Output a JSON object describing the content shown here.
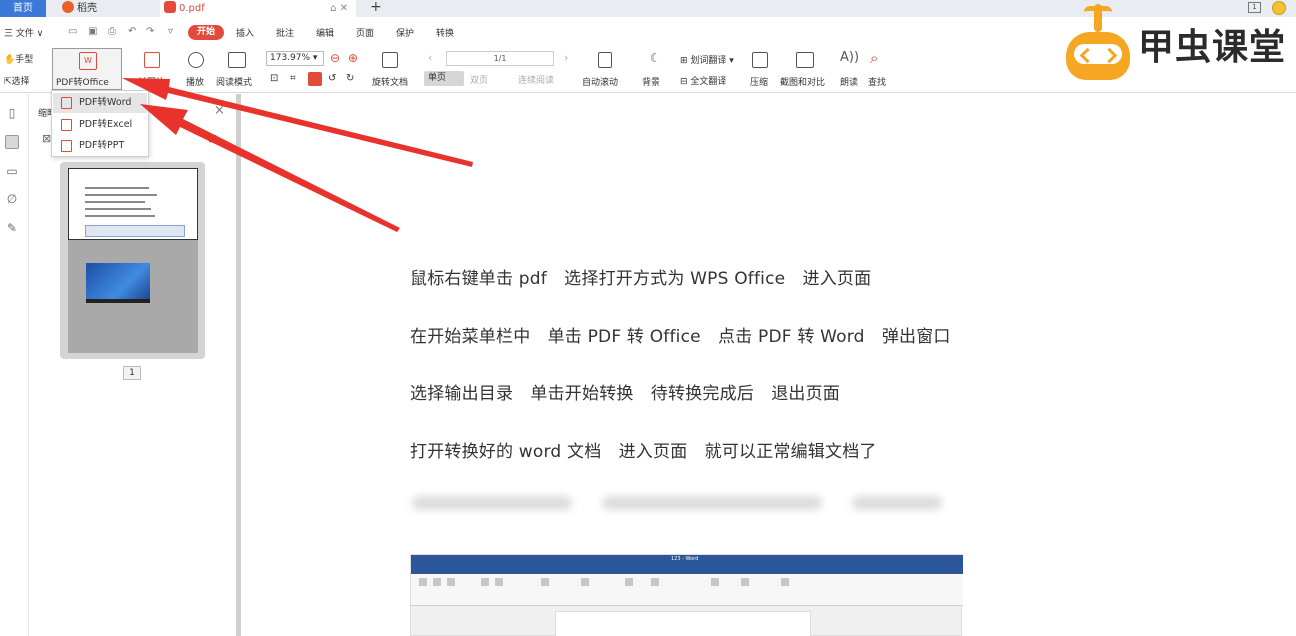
{
  "tabs": {
    "home": "首页",
    "daoke": "稻壳",
    "file": "0.pdf",
    "file_controls": "⌂ ✕",
    "new_tab": "+",
    "window_badge": "1"
  },
  "menu": {
    "file": "三 文件 ∨",
    "items": [
      "开始",
      "插入",
      "批注",
      "编辑",
      "页面",
      "保护",
      "转换"
    ]
  },
  "toolbar": {
    "hand": "手型",
    "select": "选择",
    "pdf_to_office": "PDF转Office",
    "to_image": "转图片",
    "play": "播放",
    "read_mode": "阅读模式",
    "zoom": "173.97%",
    "rotate_doc": "旋转文档",
    "page_indicator": "1/1",
    "single": "单页",
    "double": "双页",
    "continuous": "连续阅读",
    "auto_scroll": "自动滚动",
    "background": "背景",
    "word_translate": "划词翻译",
    "full_translate": "全文翻译",
    "compress": "压缩",
    "screenshot_compare": "截图和对比",
    "read_aloud": "朗读",
    "find": "查找"
  },
  "dropdown": {
    "items": [
      "PDF转Word",
      "PDF转Excel",
      "PDF转PPT"
    ]
  },
  "thumb_panel": {
    "title": "缩略",
    "page_number": "1"
  },
  "document": {
    "lines": [
      "鼠标右键单击 pdf　选择打开方式为 WPS Office　进入页面",
      "在开始菜单栏中　单击 PDF 转 Office　点击 PDF 转 Word　弹出窗口",
      "选择输出目录　单击开始转换　待转换完成后　退出页面",
      "打开转换好的 word 文档　进入页面　就可以正常编辑文档了"
    ],
    "embedded_title": "123 - Word"
  },
  "logo": {
    "text": "甲虫课堂"
  },
  "colors": {
    "accent_blue": "#3b78d8",
    "start_red": "#e24a3b",
    "arrow_red": "#e8322c",
    "logo_orange": "#f5a623",
    "word_blue": "#2b579a"
  }
}
